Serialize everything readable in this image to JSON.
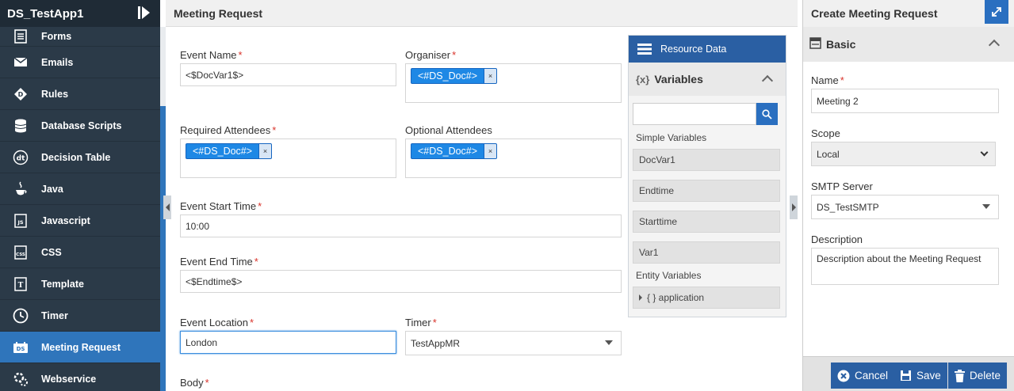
{
  "app": {
    "title": "DS_TestApp1"
  },
  "sidebar": {
    "items": [
      {
        "label": "Forms",
        "icon": "forms-icon"
      },
      {
        "label": "Emails",
        "icon": "email-icon"
      },
      {
        "label": "Rules",
        "icon": "rules-icon"
      },
      {
        "label": "Database Scripts",
        "icon": "database-icon"
      },
      {
        "label": "Decision Table",
        "icon": "decision-table-icon"
      },
      {
        "label": "Java",
        "icon": "java-icon"
      },
      {
        "label": "Javascript",
        "icon": "javascript-icon"
      },
      {
        "label": "CSS",
        "icon": "css-icon"
      },
      {
        "label": "Template",
        "icon": "template-icon"
      },
      {
        "label": "Timer",
        "icon": "timer-icon"
      },
      {
        "label": "Meeting Request",
        "icon": "meeting-request-icon",
        "active": true
      },
      {
        "label": "Webservice",
        "icon": "webservice-icon"
      }
    ]
  },
  "main": {
    "title": "Meeting Request",
    "event_name": {
      "label": "Event Name",
      "value": "<$DocVar1$>"
    },
    "organiser": {
      "label": "Organiser",
      "chip": "<#DS_Doc#>"
    },
    "required_attendees": {
      "label": "Required Attendees",
      "chip": "<#DS_Doc#>"
    },
    "optional_attendees": {
      "label": "Optional Attendees",
      "chip": "<#DS_Doc#>"
    },
    "event_start_time": {
      "label": "Event Start Time",
      "value": "10:00"
    },
    "event_end_time": {
      "label": "Event End Time",
      "value": "<$Endtime$>"
    },
    "event_location": {
      "label": "Event Location",
      "value": "London"
    },
    "timer": {
      "label": "Timer",
      "value": "TestAppMR"
    },
    "body": {
      "label": "Body"
    },
    "required_mark": "*",
    "chip_remove": "×"
  },
  "resource": {
    "title": "Resource Data",
    "variables_title": "Variables",
    "variables_icon_text": "{x}",
    "simple_label": "Simple Variables",
    "simple_vars": [
      "DocVar1",
      "Endtime",
      "Starttime",
      "Var1"
    ],
    "entity_label": "Entity Variables",
    "entity_item": "{ } application"
  },
  "right": {
    "title": "Create Meeting Request",
    "section": "Basic",
    "name": {
      "label": "Name",
      "value": "Meeting 2"
    },
    "scope": {
      "label": "Scope",
      "value": "Local"
    },
    "smtp": {
      "label": "SMTP Server",
      "value": "DS_TestSMTP"
    },
    "description": {
      "label": "Description",
      "value": "Description about the Meeting Request"
    },
    "buttons": {
      "cancel": "Cancel",
      "save": "Save",
      "delete": "Delete"
    }
  },
  "colors": {
    "accent": "#2f75bb",
    "sidebar_bg": "#2b3a48",
    "required": "#d9332b"
  }
}
